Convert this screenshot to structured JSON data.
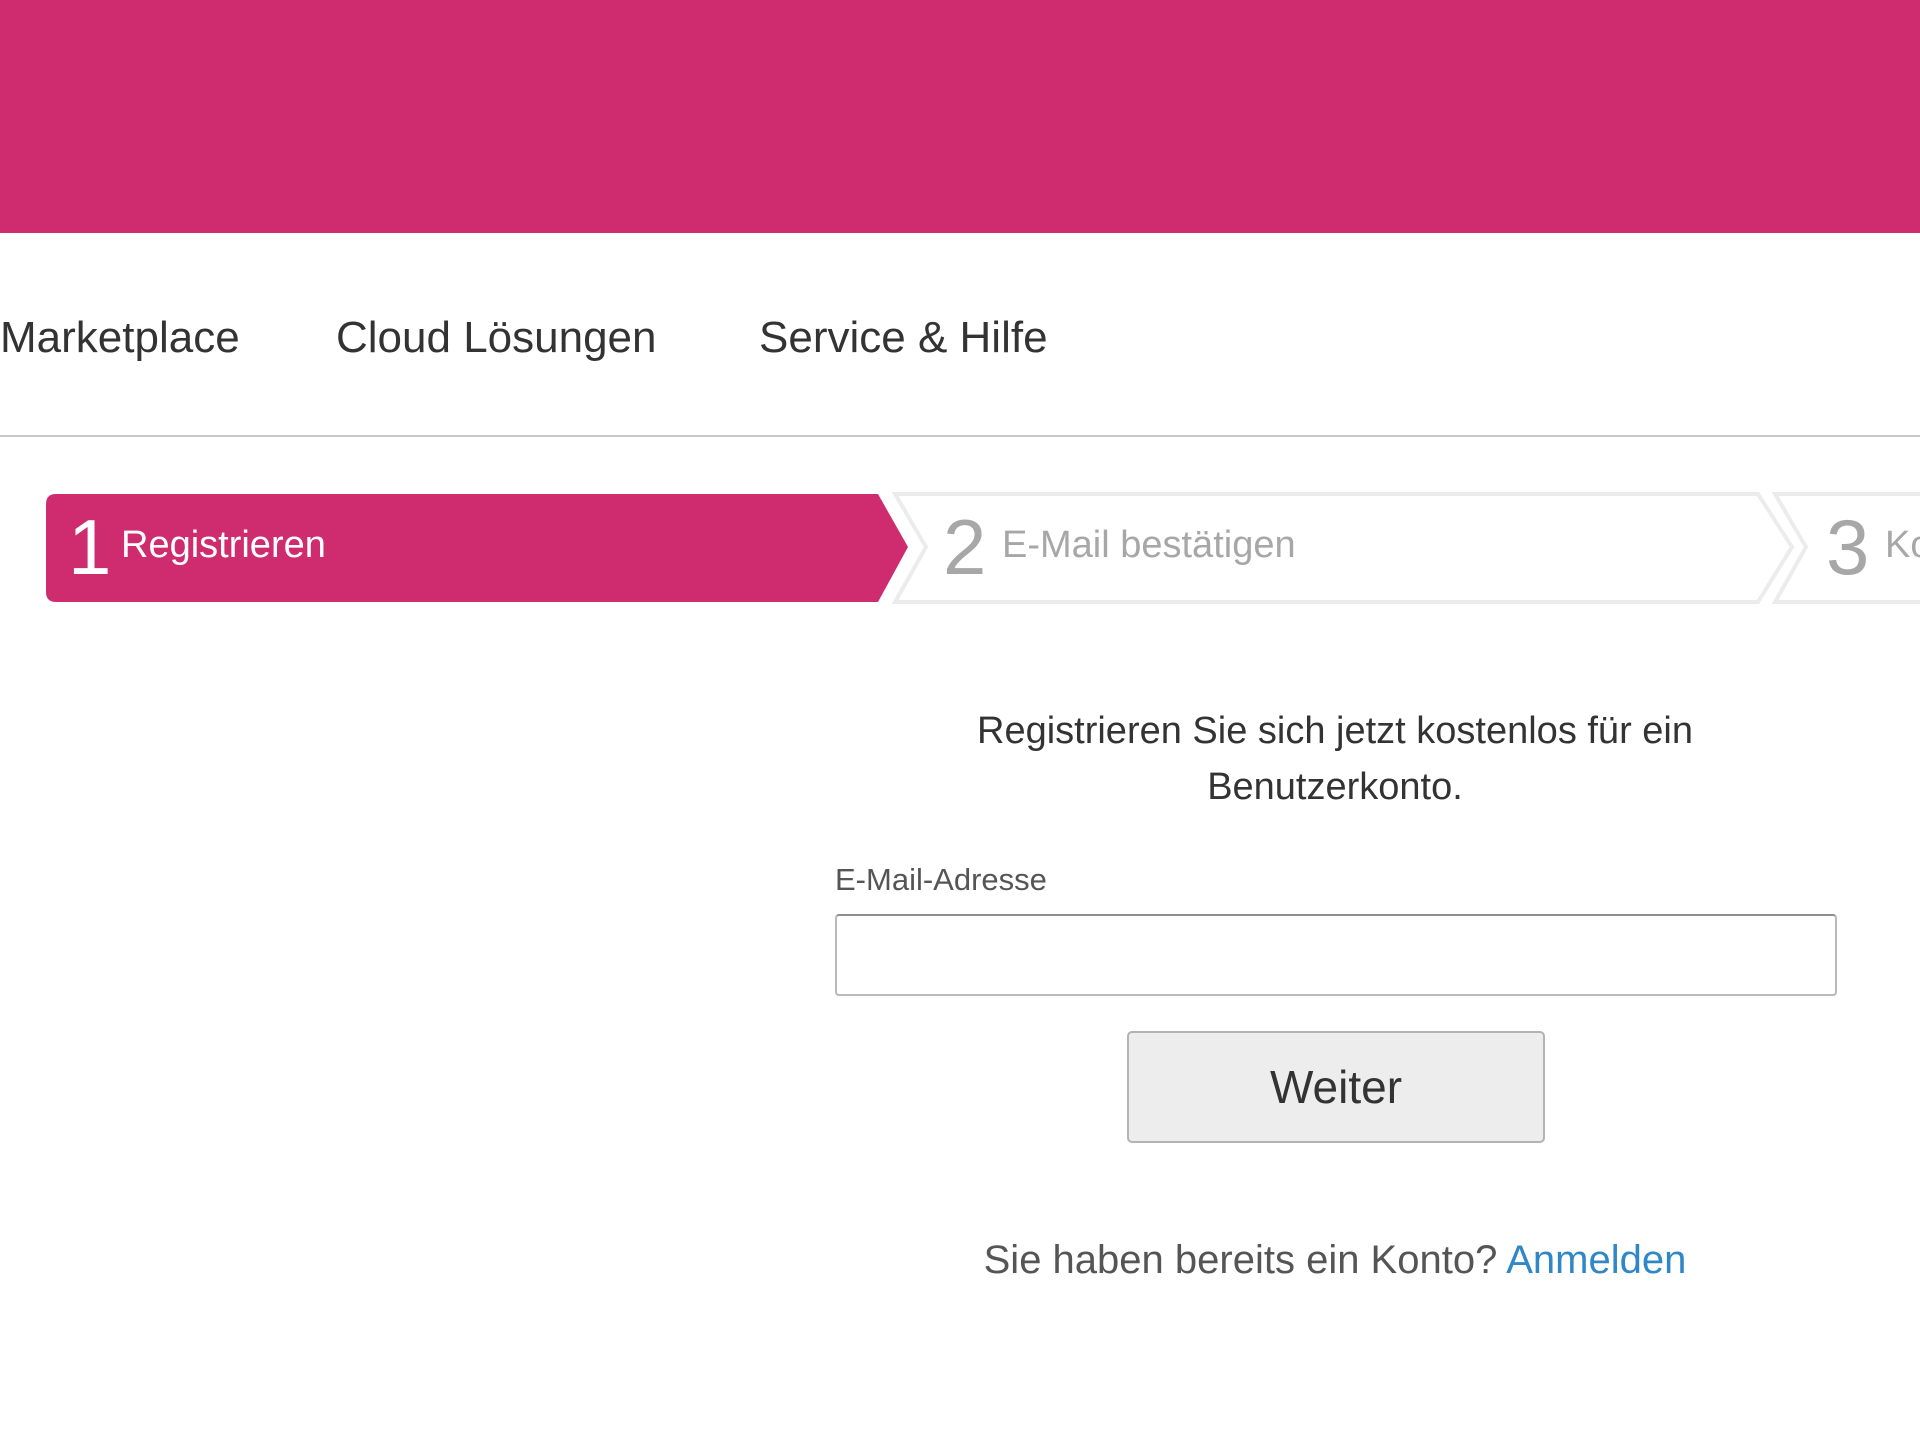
{
  "colors": {
    "brand": "#cf2c70",
    "link": "#2f87c8",
    "inactive_step": "#a7a7a7"
  },
  "nav": {
    "items": [
      {
        "label": "Marketplace"
      },
      {
        "label": "Cloud Lösungen"
      },
      {
        "label": "Service & Hilfe"
      }
    ]
  },
  "stepper": {
    "steps": [
      {
        "number": "1",
        "label": "Registrieren",
        "state": "active"
      },
      {
        "number": "2",
        "label": "E-Mail bestätigen",
        "state": "inactive"
      },
      {
        "number": "3",
        "label": "Ko",
        "state": "inactive"
      }
    ]
  },
  "form": {
    "intro": "Registrieren Sie sich jetzt kostenlos für ein Benutzerkonto.",
    "email_label": "E-Mail-Adresse",
    "email_value": "",
    "submit_label": "Weiter",
    "login_prompt": "Sie haben bereits ein Konto?",
    "login_link": "Anmelden"
  }
}
